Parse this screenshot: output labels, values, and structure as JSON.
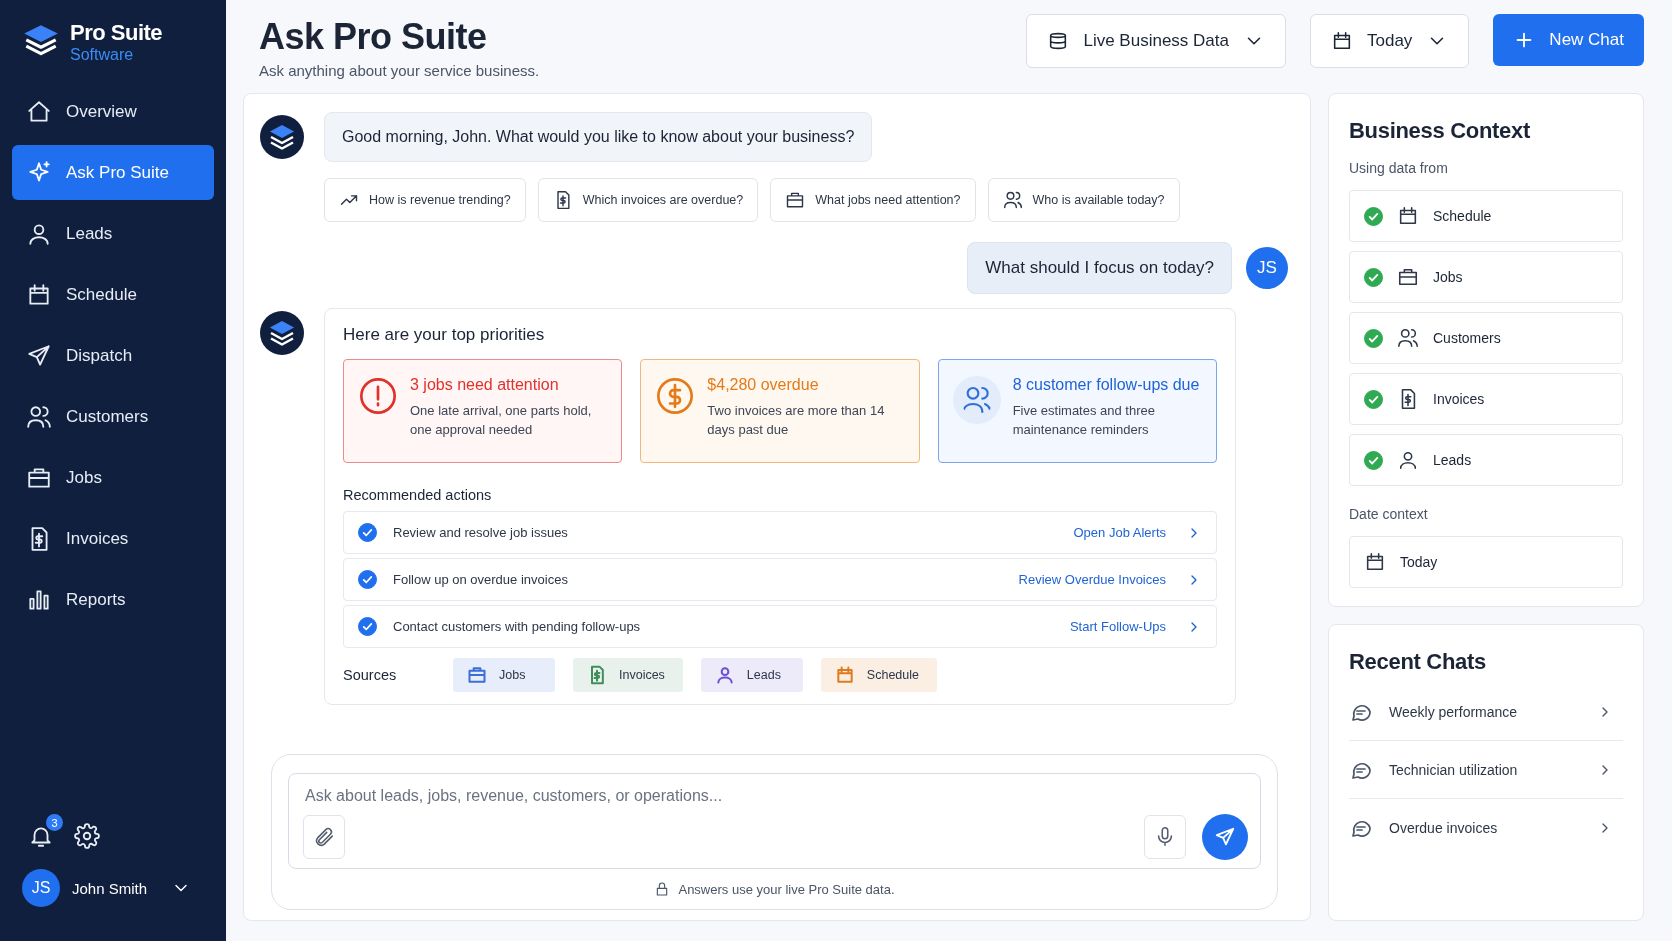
{
  "brand": {
    "name": "Pro Suite",
    "tagline": "Software"
  },
  "nav": [
    {
      "label": "Overview",
      "selected": false
    },
    {
      "label": "Ask Pro Suite",
      "selected": true
    },
    {
      "label": "Leads",
      "selected": false
    },
    {
      "label": "Schedule",
      "selected": false
    },
    {
      "label": "Dispatch",
      "selected": false
    },
    {
      "label": "Customers",
      "selected": false
    },
    {
      "label": "Jobs",
      "selected": false
    },
    {
      "label": "Invoices",
      "selected": false
    },
    {
      "label": "Reports",
      "selected": false
    }
  ],
  "notifications": {
    "count": "3"
  },
  "user": {
    "initials": "JS",
    "name": "John Smith"
  },
  "header": {
    "title": "Ask Pro Suite",
    "subtitle": "Ask anything about your service business.",
    "data_source": "Live Business Data",
    "date": "Today",
    "new_chat": "New Chat"
  },
  "chat": {
    "greeting": "Good morning, John. What would you like to know about your business?",
    "suggestions": [
      "How is revenue trending?",
      "Which invoices are overdue?",
      "What jobs need attention?",
      "Who is available today?"
    ],
    "user_message": {
      "initials": "JS",
      "text": "What should I focus on today?"
    },
    "answer": {
      "title": "Here are your top priorities",
      "cards": [
        {
          "kind": "urgent",
          "title": "3 jobs need attention",
          "text": "One late arrival, one parts hold, one approval needed"
        },
        {
          "kind": "billing",
          "title": "$4,280 overdue",
          "text": "Two invoices are more than 14 days past due"
        },
        {
          "kind": "followup",
          "title": "8 customer follow-ups due",
          "text": "Five estimates and three maintenance reminders"
        }
      ],
      "actions_title": "Recommended actions",
      "actions": [
        {
          "text": "Review and resolve job issues",
          "checked": true,
          "link": "Open Job Alerts"
        },
        {
          "text": "Follow up on overdue invoices",
          "checked": true,
          "link": "Review Overdue Invoices"
        },
        {
          "text": "Contact customers with pending follow-ups",
          "checked": true,
          "link": "Start Follow-Ups"
        }
      ],
      "sources_label": "Sources",
      "sources": [
        {
          "label": "Jobs",
          "color": "#3b6fd8"
        },
        {
          "label": "Invoices",
          "color": "#3f8f5a"
        },
        {
          "label": "Leads",
          "color": "#6d4fd6"
        },
        {
          "label": "Schedule",
          "color": "#e07a1f"
        }
      ]
    }
  },
  "composer": {
    "placeholder": "Ask about leads, jobs, revenue, customers, or operations...",
    "note": "Answers use your live Pro Suite data."
  },
  "context": {
    "title": "Business Context",
    "using_label": "Using data from",
    "sources": [
      {
        "label": "Schedule",
        "checked": true
      },
      {
        "label": "Jobs",
        "checked": true
      },
      {
        "label": "Customers",
        "checked": true
      },
      {
        "label": "Invoices",
        "checked": true
      },
      {
        "label": "Leads",
        "checked": true
      }
    ],
    "date_label": "Date context",
    "date": "Today"
  },
  "recent": {
    "title": "Recent Chats",
    "items": [
      "Weekly performance",
      "Technician utilization",
      "Overdue invoices"
    ]
  }
}
